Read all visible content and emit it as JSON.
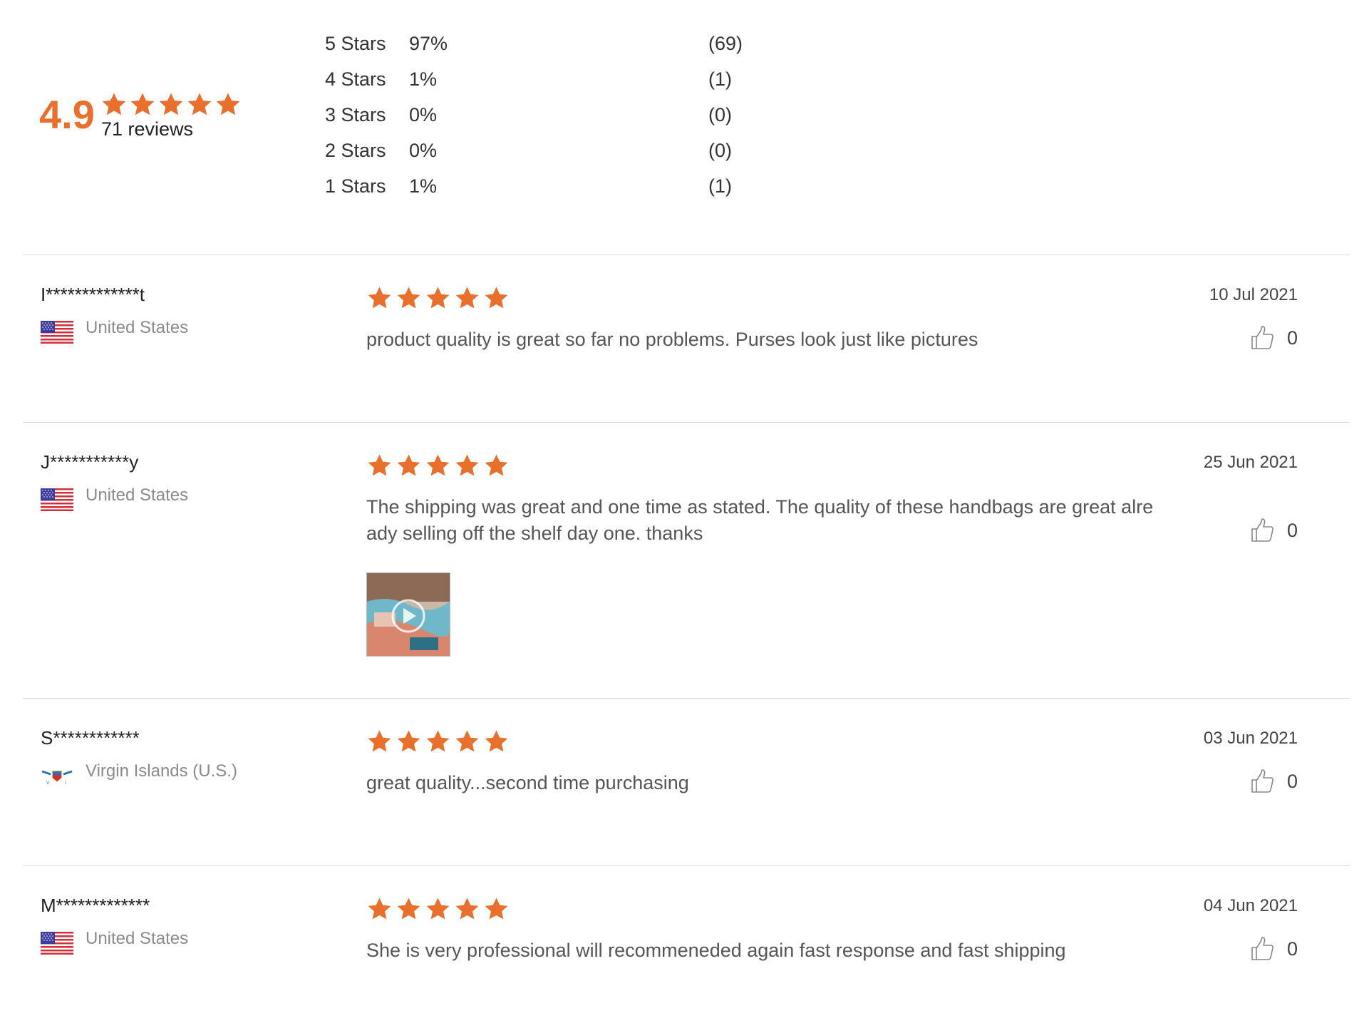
{
  "summary": {
    "average": "4.9",
    "reviews_label": "71 reviews",
    "distribution": [
      {
        "label": "5  Stars",
        "pct": "97%",
        "count": "(69)"
      },
      {
        "label": "4  Stars",
        "pct": "1%",
        "count": "(1)"
      },
      {
        "label": "3  Stars",
        "pct": "0%",
        "count": "(0)"
      },
      {
        "label": "2  Stars",
        "pct": "0%",
        "count": "(0)"
      },
      {
        "label": "1  Stars",
        "pct": "1%",
        "count": "(1)"
      }
    ]
  },
  "colors": {
    "accent": "#e96f2c",
    "divider": "#dcdcdc",
    "muted": "#8a8a8a"
  },
  "reviews": [
    {
      "name": "I*************t",
      "country": "United States",
      "flag": "us-flag-icon",
      "rating": 5,
      "date": "10 Jul 2021",
      "text": "product quality is great so far no problems. Purses look just like pictures",
      "likes": "0"
    },
    {
      "name": "J***********y",
      "country": "United States",
      "flag": "us-flag-icon",
      "rating": 5,
      "date": "25 Jun 2021",
      "text": "The shipping was great and one time as stated. The quality of these handbags are great alre ady selling off the shelf day one. thanks",
      "likes": "0",
      "has_image": true
    },
    {
      "name": "S************",
      "country": "Virgin Islands (U.S.)",
      "flag": "usvi-flag-icon",
      "rating": 5,
      "date": "03 Jun 2021",
      "text": "great quality...second time purchasing",
      "likes": "0"
    },
    {
      "name": "M*************",
      "country": "United States",
      "flag": "us-flag-icon",
      "rating": 5,
      "date": "04 Jun 2021",
      "text": "She is very professional will recommeneded again fast response and fast shipping",
      "likes": "0"
    }
  ]
}
